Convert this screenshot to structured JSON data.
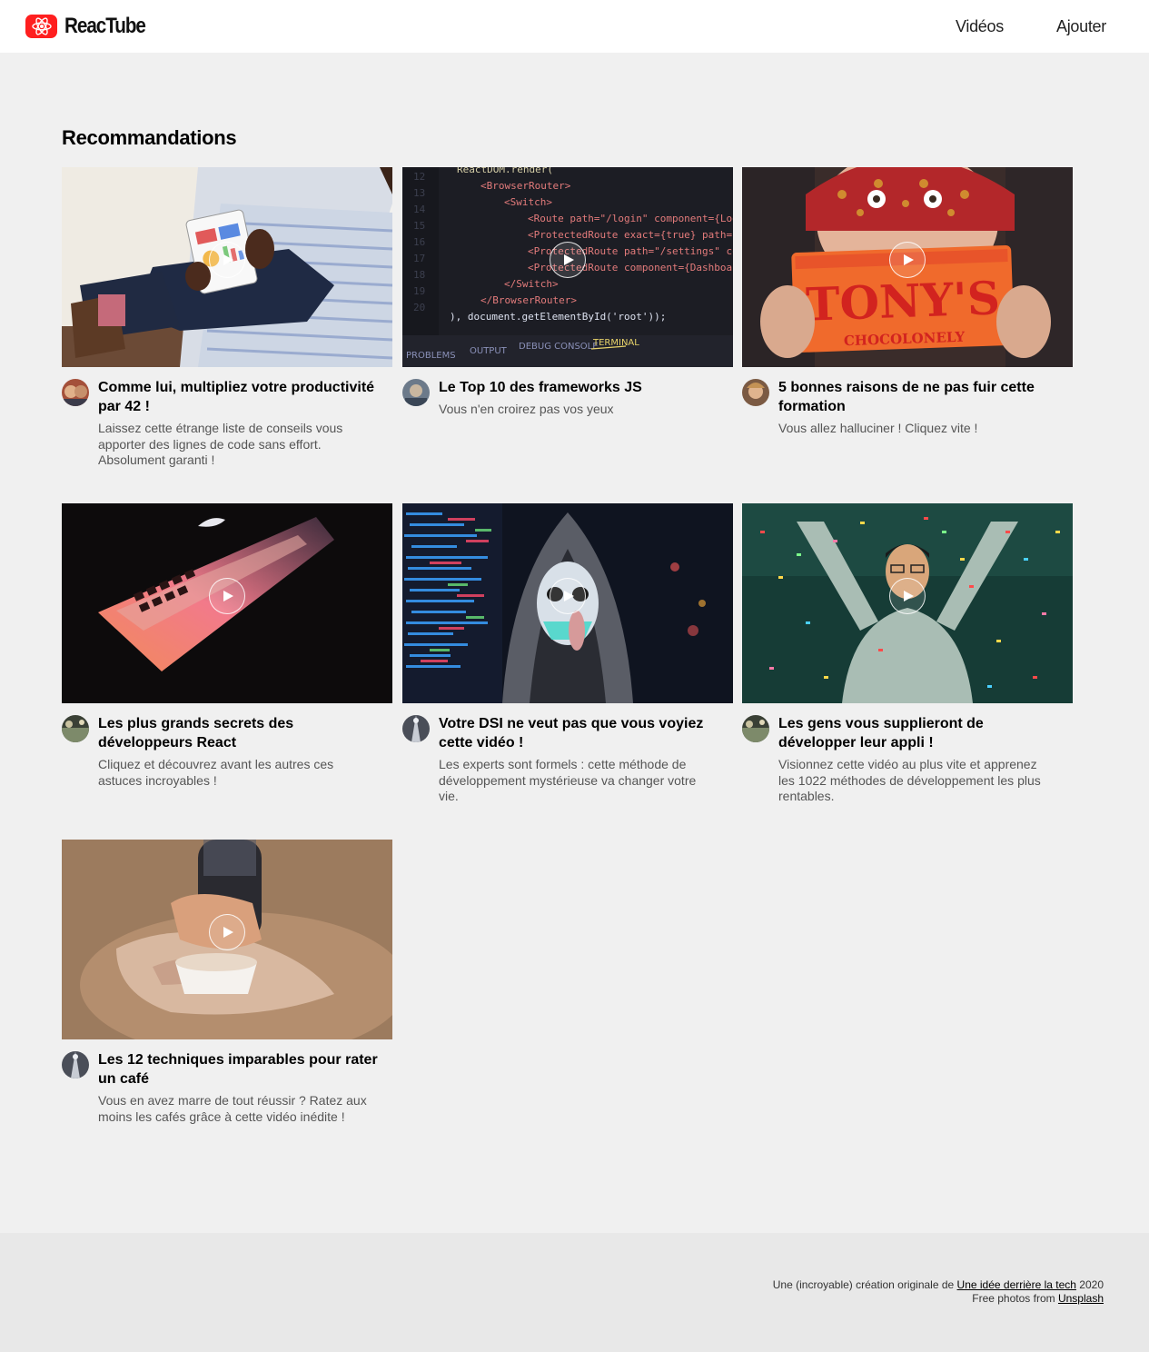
{
  "header": {
    "brand": "ReacTube",
    "nav": {
      "videos": "Vidéos",
      "add": "Ajouter"
    }
  },
  "main": {
    "section_title": "Recommandations",
    "videos": [
      {
        "title": "Comme lui, multipliez votre productivité par 42 !",
        "description": "Laissez cette étrange liste de conseils vous apporter des lignes de code sans effort. Absolument garanti !"
      },
      {
        "title": "Le Top 10 des frameworks JS",
        "description": "Vous n'en croirez pas vos yeux"
      },
      {
        "title": "5 bonnes raisons de ne pas fuir cette formation",
        "description": "Vous allez halluciner ! Cliquez vite !"
      },
      {
        "title": "Les plus grands secrets des développeurs React",
        "description": "Cliquez et découvrez avant les autres ces astuces incroyables !"
      },
      {
        "title": "Votre DSI ne veut pas que vous voyiez cette vidéo !",
        "description": "Les experts sont formels : cette méthode de développement mystérieuse va changer votre vie."
      },
      {
        "title": "Les gens vous supplieront de développer leur appli !",
        "description": "Visionnez cette vidéo au plus vite et apprenez les 1022 méthodes de développement les plus rentables."
      },
      {
        "title": "Les 12 techniques imparables pour rater un café",
        "description": "Vous en avez marre de tout réussir ? Ratez aux moins les cafés grâce à cette vidéo inédite !"
      }
    ],
    "thumbnail_text": {
      "code_lines": [
        "ReactDOM.render(",
        "<BrowserRouter>",
        "<Switch>",
        "<Route path=\"/login\" component={Login}",
        "<ProtectedRoute exact={true} path=\"/\" comp",
        "<ProtectedRoute path=\"/settings\" component=",
        "<ProtectedRoute component={Dashboard}",
        "</Switch>",
        "</BrowserRouter>",
        "), document.getElementById('root'));"
      ],
      "line_numbers": [
        "12",
        "13",
        "14",
        "15",
        "16",
        "17",
        "18",
        "19",
        "20"
      ],
      "panel_tabs": [
        "PROBLEMS",
        "OUTPUT",
        "DEBUG CONSOLE",
        "TERMINAL"
      ],
      "chocolate_brand": "TONY'S",
      "chocolate_sub": "CHOCOLONELY"
    }
  },
  "footer": {
    "line1_prefix": "Une (incroyable) création originale de ",
    "line1_link": "Une idée derrière la tech",
    "line1_suffix": " 2020",
    "line2_prefix": "Free photos from ",
    "line2_link": "Unsplash"
  },
  "colors": {
    "brand_red": "#ff1f1f",
    "background": "#f0f0f0",
    "footer_bg": "#e8e8e8"
  }
}
